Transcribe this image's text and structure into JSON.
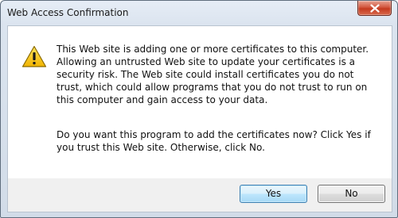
{
  "window": {
    "title": "Web Access Confirmation",
    "close_icon": "close-icon"
  },
  "dialog": {
    "icon": "warning-icon",
    "message_1": "This Web site is adding one or more certificates to this computer. Allowing an untrusted Web site to update your certificates is a security risk. The Web site could install certificates you do not trust, which could allow programs that you do not trust to run on this computer and gain access to your data.",
    "message_2": "Do you want this program to add the certificates now? Click Yes if you trust this Web site. Otherwise, click No."
  },
  "buttons": {
    "yes_label": "Yes",
    "no_label": "No"
  },
  "colors": {
    "close_button": "#c43a1f",
    "default_button_border": "#3c7fb1",
    "warning_fill": "#f5c400"
  }
}
